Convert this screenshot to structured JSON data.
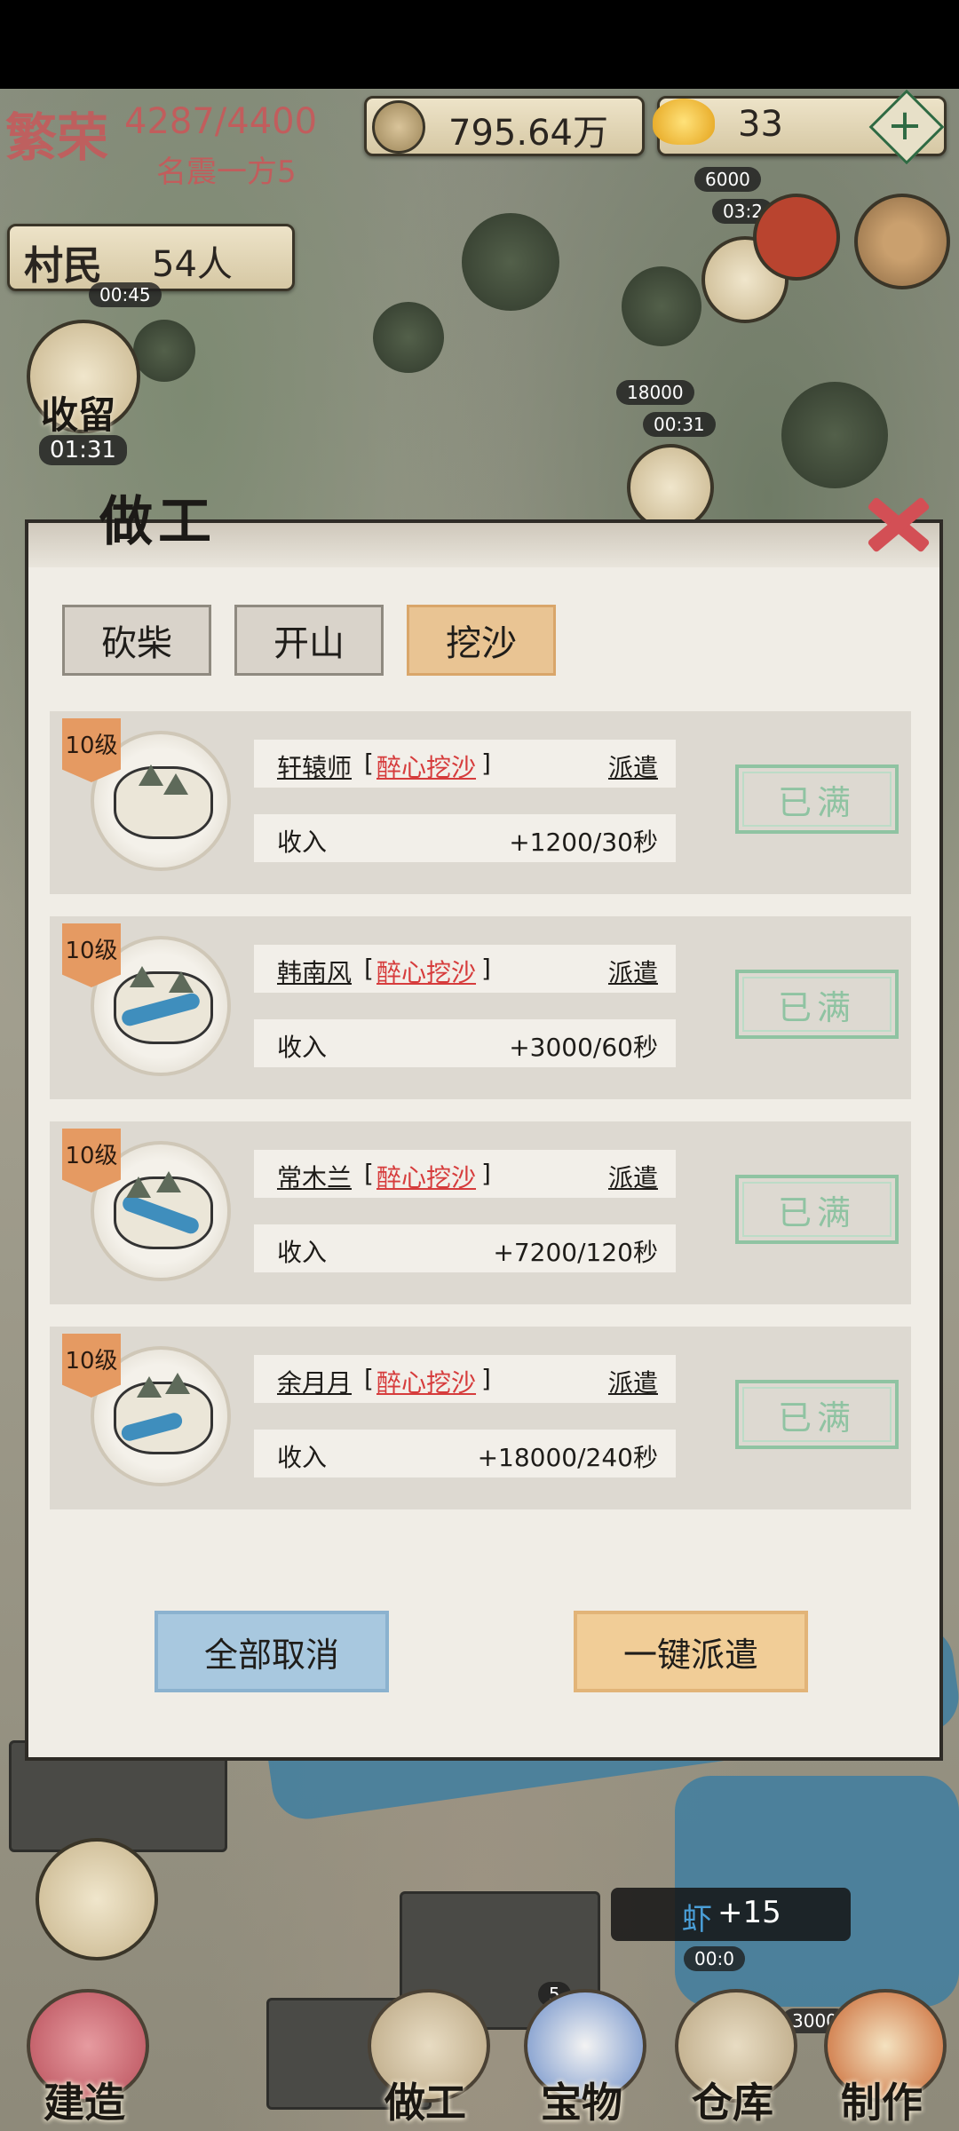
{
  "hud": {
    "prosperity_label": "繁荣",
    "prosperity_value": "4287/4400",
    "prosperity_title": "名震一方5",
    "coins": "795.64万",
    "gold": "33",
    "villagers_label": "村民",
    "villagers_value": "54人",
    "villager_timer": "00:45",
    "shelter_label": "收留",
    "shelter_timer": "01:31",
    "reward1": "6000",
    "reward1_timer": "03:2",
    "reward2": "18000",
    "reward2_timer": "00:31",
    "shrimp_label": "虾",
    "shrimp_value": "+15",
    "shrimp_timer": "00:0",
    "small_num1": "5",
    "small_num2": "3000"
  },
  "modal": {
    "title": "做工",
    "tabs": [
      "砍柴",
      "开山",
      "挖沙"
    ],
    "active_tab": 2,
    "rows": [
      {
        "level": "10级",
        "name": "轩辕师",
        "skill": "醉心挖沙",
        "dispatch": "派遣",
        "income_label": "收入",
        "income": "+1200/30秒",
        "status": "已满"
      },
      {
        "level": "10级",
        "name": "韩南风",
        "skill": "醉心挖沙",
        "dispatch": "派遣",
        "income_label": "收入",
        "income": "+3000/60秒",
        "status": "已满"
      },
      {
        "level": "10级",
        "name": "常木兰",
        "skill": "醉心挖沙",
        "dispatch": "派遣",
        "income_label": "收入",
        "income": "+7200/120秒",
        "status": "已满"
      },
      {
        "level": "10级",
        "name": "余月月",
        "skill": "醉心挖沙",
        "dispatch": "派遣",
        "income_label": "收入",
        "income": "+18000/240秒",
        "status": "已满"
      }
    ],
    "cancel_all": "全部取消",
    "dispatch_all": "一键派遣"
  },
  "nav": {
    "build": "建造",
    "work": "做工",
    "treasure": "宝物",
    "warehouse": "仓库",
    "craft": "制作"
  },
  "colors": {
    "skill_red": "#d63c3c",
    "full_green": "#8fc3a2",
    "active_tab": "#e9c493",
    "cancel_blue": "#a8c8df",
    "dispatch_orange": "#f1cd97"
  }
}
